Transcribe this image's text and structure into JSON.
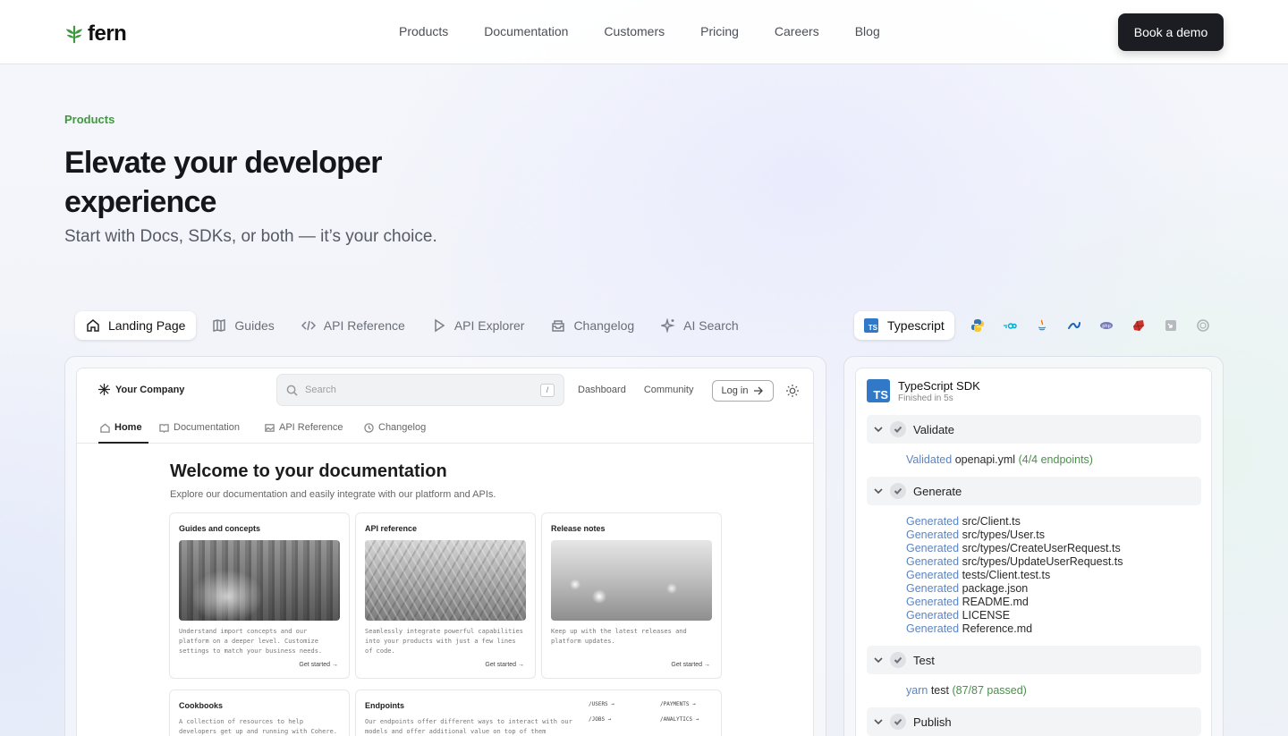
{
  "header": {
    "brand": "fern",
    "nav": [
      "Products",
      "Documentation",
      "Customers",
      "Pricing",
      "Careers",
      "Blog"
    ],
    "cta": "Book a demo"
  },
  "hero": {
    "eyebrow": "Products",
    "title": "Elevate your developer experience",
    "subtitle": "Start with Docs, SDKs, or both — it’s your choice."
  },
  "tabs": [
    {
      "label": "Landing Page",
      "icon": "home-icon",
      "active": true
    },
    {
      "label": "Guides",
      "icon": "book-icon",
      "active": false
    },
    {
      "label": "API Reference",
      "icon": "code-icon",
      "active": false
    },
    {
      "label": "API Explorer",
      "icon": "play-icon",
      "active": false
    },
    {
      "label": "Changelog",
      "icon": "inbox-icon",
      "active": false
    },
    {
      "label": "AI Search",
      "icon": "sparkle-icon",
      "active": false
    }
  ],
  "languages": {
    "active": "Typescript",
    "others": [
      "python-icon",
      "go-icon",
      "java-icon",
      "csharp-icon",
      "php-icon",
      "ruby-icon",
      "swift-icon",
      "rust-icon"
    ]
  },
  "doc_preview": {
    "company": "Your Company",
    "search_placeholder": "Search",
    "search_key": "/",
    "links": [
      "Dashboard",
      "Community"
    ],
    "login": "Log in",
    "tabs": [
      "Home",
      "Documentation",
      "API Reference",
      "Changelog"
    ],
    "heading": "Welcome to your documentation",
    "lead": "Explore our documentation and easily integrate with our platform and APIs.",
    "cards": [
      {
        "title": "Guides and concepts",
        "desc": "Understand import concepts and our platform on a deeper level. Customize settings to match your business needs.",
        "cta": "Get started →"
      },
      {
        "title": "API reference",
        "desc": "Seamlessly integrate powerful capabilities into your products with just a few lines of code.",
        "cta": "Get started →"
      },
      {
        "title": "Release notes",
        "desc": "Keep up with the latest releases and platform updates.",
        "cta": "Get started →"
      },
      {
        "title": "Cookbooks",
        "desc": "A collection of resources to help developers get up and running with Cohere."
      },
      {
        "title": "Endpoints",
        "desc": "Our endpoints offer different ways to interact with our models and offer additional value on top of them"
      }
    ],
    "endpoints": [
      "/USERS →",
      "/PAYMENTS →",
      "/JOBS →",
      "/ANALYTICS →"
    ]
  },
  "sdk": {
    "title": "TypeScript SDK",
    "subtitle": "Finished in 5s",
    "steps": [
      {
        "name": "Validate",
        "lines": [
          {
            "kw": "Validated",
            "text": "openapi.yml",
            "ok": "(4/4 endpoints)"
          }
        ]
      },
      {
        "name": "Generate",
        "lines": [
          {
            "kw": "Generated",
            "text": "src/Client.ts"
          },
          {
            "kw": "Generated",
            "text": "src/types/User.ts"
          },
          {
            "kw": "Generated",
            "text": "src/types/CreateUserRequest.ts"
          },
          {
            "kw": "Generated",
            "text": "src/types/UpdateUserRequest.ts"
          },
          {
            "kw": "Generated",
            "text": "tests/Client.test.ts"
          },
          {
            "kw": "Generated",
            "text": "package.json"
          },
          {
            "kw": "Generated",
            "text": "README.md"
          },
          {
            "kw": "Generated",
            "text": "LICENSE"
          },
          {
            "kw": "Generated",
            "text": "Reference.md"
          }
        ]
      },
      {
        "name": "Test",
        "lines": [
          {
            "kw": "yarn",
            "text": "test",
            "ok": "(87/87 passed)"
          }
        ]
      },
      {
        "name": "Publish",
        "lines": []
      }
    ]
  },
  "colors": {
    "accent": "#3e9a3d",
    "ts_blue": "#3178c6",
    "link_blue": "#5a84c4",
    "ok_green": "#4a8f4a"
  }
}
